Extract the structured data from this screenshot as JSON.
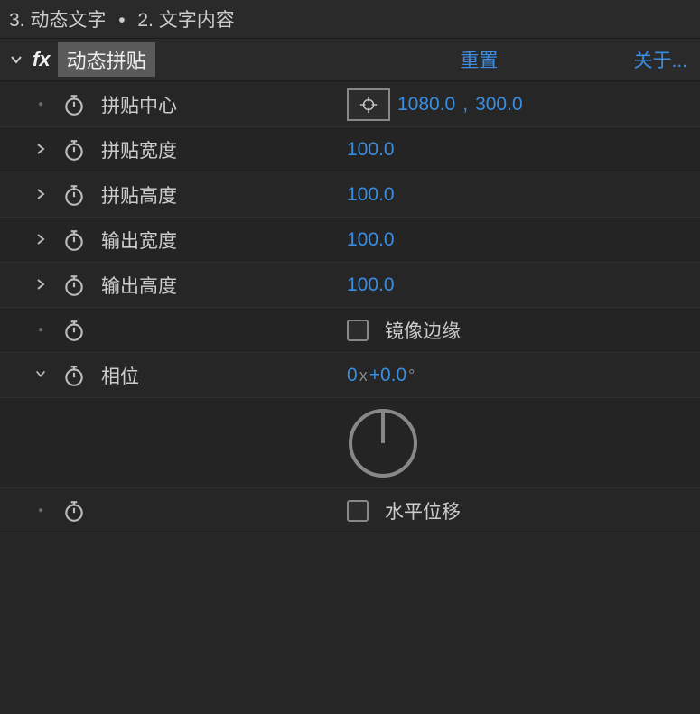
{
  "breadcrumb": {
    "item1": "3. 动态文字",
    "sep": "•",
    "item2": "2. 文字内容"
  },
  "effect": {
    "fx_badge": "fx",
    "name": "动态拼贴",
    "reset": "重置",
    "about": "关于..."
  },
  "props": {
    "tile_center": {
      "label": "拼贴中心",
      "x": "1080.0",
      "y": "300.0"
    },
    "tile_width": {
      "label": "拼贴宽度",
      "value": "100.0"
    },
    "tile_height": {
      "label": "拼贴高度",
      "value": "100.0"
    },
    "output_width": {
      "label": "输出宽度",
      "value": "100.0"
    },
    "output_height": {
      "label": "输出高度",
      "value": "100.0"
    },
    "mirror_edges": {
      "label": "镜像边缘"
    },
    "phase": {
      "label": "相位",
      "revolutions": "0",
      "x_sep": "x",
      "plus": "+",
      "degrees": "0.0",
      "deg_unit": "°"
    },
    "horizontal_shift": {
      "label": "水平位移"
    }
  }
}
